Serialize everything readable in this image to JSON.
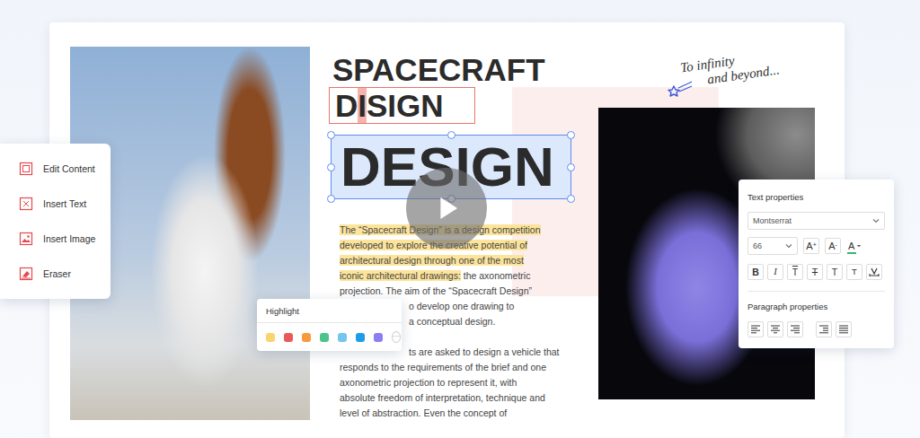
{
  "toolbar": {
    "items": [
      {
        "label": "Edit Content",
        "kind": "edit"
      },
      {
        "label": "Insert Text",
        "kind": "text"
      },
      {
        "label": "Insert Image",
        "kind": "image"
      },
      {
        "label": "Eraser",
        "kind": "eraser"
      }
    ]
  },
  "document": {
    "title": "SPACECRAFT",
    "misspelled": [
      {
        "text": "D",
        "marked": false
      },
      {
        "text": "I",
        "marked": true
      },
      {
        "text": "SIGN",
        "marked": false
      }
    ],
    "selected_word": "DESIGN",
    "paragraphs": [
      {
        "lines": [
          {
            "covered": false,
            "segments": [
              {
                "text": "The “Spacecraft Design” is a design competition",
                "highlighted": true
              }
            ]
          },
          {
            "covered": false,
            "segments": [
              {
                "text": "developed to explore the creative potential of",
                "highlighted": true
              }
            ]
          },
          {
            "covered": false,
            "segments": [
              {
                "text": "architectural design through one of the most",
                "highlighted": true
              }
            ]
          },
          {
            "covered": false,
            "segments": [
              {
                "text": "iconic architectural drawings:",
                "highlighted": true
              },
              {
                "text": " the axonometric",
                "highlighted": false
              }
            ]
          },
          {
            "covered": false,
            "segments": [
              {
                "text": "projection. The aim of the “Spacecraft Design”",
                "highlighted": false
              }
            ]
          },
          {
            "covered": true,
            "segments": [
              {
                "text": "o develop one drawing to",
                "highlighted": false
              }
            ]
          },
          {
            "covered": true,
            "segments": [
              {
                "text": "a conceptual design.",
                "highlighted": false
              }
            ]
          }
        ]
      },
      {
        "lines": [
          {
            "covered": true,
            "segments": [
              {
                "text": "ts are asked to design a vehicle that",
                "highlighted": false
              }
            ]
          },
          {
            "covered": false,
            "segments": [
              {
                "text": "responds to the requirements of the brief and one",
                "highlighted": false
              }
            ]
          },
          {
            "covered": false,
            "segments": [
              {
                "text": "axonometric projection to represent it, with",
                "highlighted": false
              }
            ]
          },
          {
            "covered": false,
            "segments": [
              {
                "text": "absolute freedom of interpretation, technique and",
                "highlighted": false
              }
            ]
          },
          {
            "covered": false,
            "segments": [
              {
                "text": "level of abstraction. Even the concept of",
                "highlighted": false
              }
            ]
          }
        ]
      }
    ]
  },
  "note": {
    "lines": [
      "To infinity",
      "and beyond..."
    ]
  },
  "highlight_popup": {
    "title": "Highlight",
    "swatches": [
      {
        "color": "#f9d56e"
      },
      {
        "color": "#e85a5a"
      },
      {
        "color": "#f79a3a"
      },
      {
        "color": "#4cc38a"
      },
      {
        "color": "#74c6ee"
      },
      {
        "color": "#1a9ee8"
      },
      {
        "color": "#8a7ff0"
      }
    ],
    "more": "···"
  },
  "text_properties": {
    "title": "Text properties",
    "font": "Montserrat",
    "size": "66",
    "size_buttons": [
      {
        "letter": "A",
        "mark": "+"
      },
      {
        "letter": "A",
        "mark": "-"
      }
    ],
    "font_color": {
      "glyph": "A",
      "color": "#3cb371"
    },
    "style_buttons": [
      {
        "glyph": "B",
        "kind": "bold"
      },
      {
        "glyph": "I",
        "kind": "italic"
      },
      {
        "glyph": "T",
        "kind": "overline"
      },
      {
        "glyph": "T",
        "kind": "strike"
      },
      {
        "glyph": "T",
        "kind": "plain"
      },
      {
        "glyph": "T",
        "kind": "subscript"
      }
    ],
    "paragraph_title": "Paragraph properties",
    "align_buttons": [
      {
        "kind": "left"
      },
      {
        "kind": "center"
      },
      {
        "kind": "right"
      }
    ],
    "indent_buttons": [
      {
        "kind": "indent"
      },
      {
        "kind": "justify"
      }
    ]
  }
}
